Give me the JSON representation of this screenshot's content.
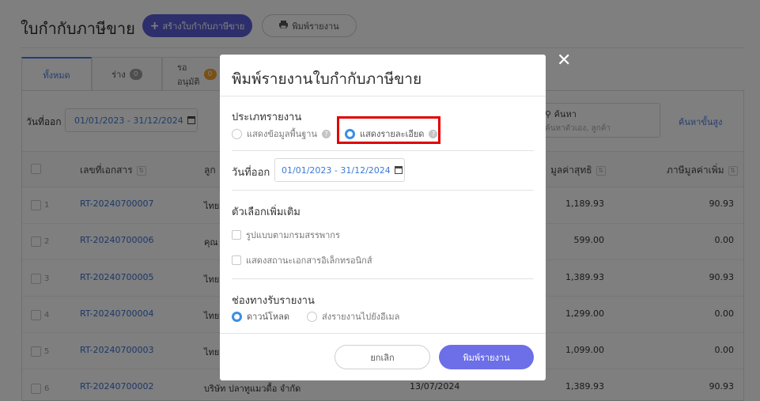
{
  "page": {
    "title": "ใบกำกับภาษีขาย",
    "create_button": "สร้างใบกำกับภาษีขาย",
    "print_button": "พิมพ์รายงาน"
  },
  "tabs": [
    {
      "label": "ทั้งหมด",
      "count": ""
    },
    {
      "label": "ร่าง",
      "count": "0"
    },
    {
      "label": "รออนุมัติ",
      "count": "0"
    }
  ],
  "filters": {
    "date_label": "วันที่ออก",
    "date_range": "01/01/2023 - 31/12/2024",
    "search_label": "ค้นหา",
    "search_placeholder": "ค้นหาตัวเอง, ลูกค้า",
    "advanced_search": "ค้นหาขั้นสูง"
  },
  "table": {
    "headers": [
      "เลขที่เอกสาร",
      "ลูก",
      "มูลค่าสุทธิ",
      "ภาษีมูลค่าเพิ่ม"
    ],
    "rows": [
      {
        "num": "1",
        "doc": "RT-20240700007",
        "customer": "ไทย",
        "date": "",
        "net": "1,189.93",
        "vat": "90.93"
      },
      {
        "num": "2",
        "doc": "RT-20240700006",
        "customer": "คุณ",
        "date": "",
        "net": "599.00",
        "vat": "0.00"
      },
      {
        "num": "3",
        "doc": "RT-20240700005",
        "customer": "ไทย",
        "date": "",
        "net": "1,389.93",
        "vat": "90.93"
      },
      {
        "num": "4",
        "doc": "RT-20240700004",
        "customer": "ไทย",
        "date": "",
        "net": "1,299.00",
        "vat": "0.00"
      },
      {
        "num": "5",
        "doc": "RT-20240700003",
        "customer": "ไทย",
        "date": "",
        "net": "1,099.00",
        "vat": "0.00"
      },
      {
        "num": "6",
        "doc": "RT-20240700002",
        "customer": "บริษัท ปลาทูแมวดื้อ จำกัด",
        "date": "13/07/2024",
        "net": "1,389.93",
        "vat": "90.93"
      }
    ]
  },
  "modal": {
    "title": "พิมพ์รายงานใบกำกับภาษีขาย",
    "report_type_label": "ประเภทรายงาน",
    "report_type_options": [
      "แสดงข้อมูลพื้นฐาน",
      "แสดงรายละเอียด"
    ],
    "report_type_selected": "แสดงรายละเอียด",
    "date_label": "วันที่ออก",
    "date_range": "01/01/2023 - 31/12/2024",
    "extra_label": "ตัวเลือกเพิ่มเติม",
    "extra_options": [
      "รูปแบบตามกรมสรรพากร",
      "แสดงสถานะเอกสารอิเล็กทรอนิกส์"
    ],
    "channel_label": "ช่องทางรับรายงาน",
    "channel_options": [
      "ดาวน์โหลด",
      "ส่งรายงานไปยังอีเมล"
    ],
    "channel_selected": "ดาวน์โหลด",
    "cancel_button": "ยกเลิก",
    "print_button": "พิมพ์รายงาน",
    "close_symbol": "✕"
  },
  "colors": {
    "primary": "#5a5fd8",
    "print_button": "#6c6fe8",
    "link": "#3a6fd0",
    "radio_active": "#3a8ee6",
    "highlight": "#e00000"
  },
  "icons": [
    "plus-icon",
    "printer-icon",
    "calendar-icon",
    "search-icon",
    "sort-icon",
    "help-icon",
    "close-icon"
  ]
}
